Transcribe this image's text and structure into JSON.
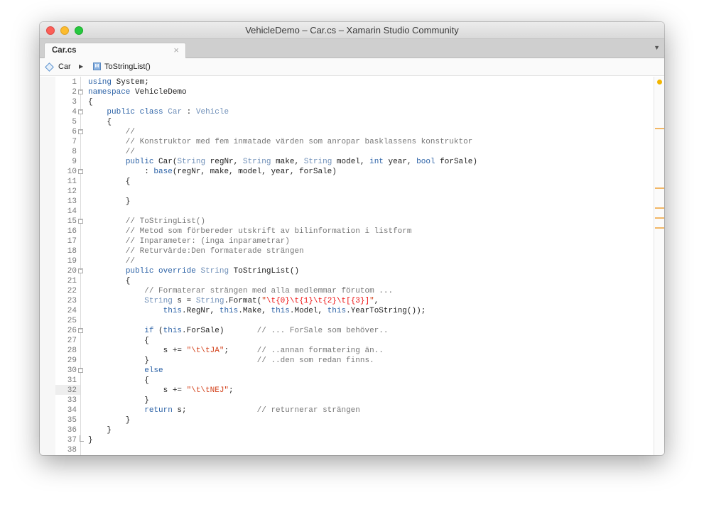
{
  "window": {
    "title": "VehicleDemo – Car.cs – Xamarin Studio Community"
  },
  "tabs": [
    {
      "label": "Car.cs",
      "close": "×"
    }
  ],
  "tab_dropdown": "▼",
  "breadcrumb": {
    "class_name": "Car",
    "separator": "▶",
    "method_icon_letter": "M",
    "method_name": "ToStringList()"
  },
  "editor": {
    "current_line": 32,
    "lines": [
      {
        "n": "1",
        "fold": "",
        "segs": [
          [
            "k",
            "using"
          ],
          [
            "p",
            " System;"
          ]
        ]
      },
      {
        "n": "2",
        "fold": "open",
        "segs": [
          [
            "k",
            "namespace"
          ],
          [
            "p",
            " VehicleDemo"
          ]
        ]
      },
      {
        "n": "3",
        "fold": "",
        "segs": [
          [
            "p",
            "{"
          ]
        ]
      },
      {
        "n": "4",
        "fold": "open",
        "segs": [
          [
            "p",
            "    "
          ],
          [
            "k",
            "public"
          ],
          [
            "p",
            " "
          ],
          [
            "k",
            "class"
          ],
          [
            "p",
            " "
          ],
          [
            "t",
            "Car"
          ],
          [
            "p",
            " : "
          ],
          [
            "t",
            "Vehicle"
          ]
        ]
      },
      {
        "n": "5",
        "fold": "",
        "segs": [
          [
            "p",
            "    {"
          ]
        ]
      },
      {
        "n": "6",
        "fold": "open",
        "segs": [
          [
            "c",
            "        //"
          ]
        ]
      },
      {
        "n": "7",
        "fold": "",
        "segs": [
          [
            "c",
            "        // Konstruktor med fem inmatade värden som anropar basklassens konstruktor"
          ]
        ]
      },
      {
        "n": "8",
        "fold": "",
        "segs": [
          [
            "c",
            "        //"
          ]
        ]
      },
      {
        "n": "9",
        "fold": "",
        "segs": [
          [
            "p",
            "        "
          ],
          [
            "k",
            "public"
          ],
          [
            "p",
            " Car("
          ],
          [
            "t",
            "String"
          ],
          [
            "p",
            " regNr, "
          ],
          [
            "t",
            "String"
          ],
          [
            "p",
            " make, "
          ],
          [
            "t",
            "String"
          ],
          [
            "p",
            " model, "
          ],
          [
            "k",
            "int"
          ],
          [
            "p",
            " year, "
          ],
          [
            "k",
            "bool"
          ],
          [
            "p",
            " forSale)"
          ]
        ]
      },
      {
        "n": "10",
        "fold": "open",
        "segs": [
          [
            "p",
            "            : "
          ],
          [
            "k",
            "base"
          ],
          [
            "p",
            "(regNr, make, model, year, forSale)"
          ]
        ]
      },
      {
        "n": "11",
        "fold": "",
        "segs": [
          [
            "p",
            "        {"
          ]
        ]
      },
      {
        "n": "12",
        "fold": "",
        "segs": []
      },
      {
        "n": "13",
        "fold": "",
        "segs": [
          [
            "p",
            "        }"
          ]
        ]
      },
      {
        "n": "14",
        "fold": "",
        "segs": []
      },
      {
        "n": "15",
        "fold": "open",
        "segs": [
          [
            "c",
            "        // ToStringList()"
          ]
        ]
      },
      {
        "n": "16",
        "fold": "",
        "segs": [
          [
            "c",
            "        // Metod som förbereder utskrift av bilinformation i listform"
          ]
        ]
      },
      {
        "n": "17",
        "fold": "",
        "segs": [
          [
            "c",
            "        // Inparameter: (inga inparametrar)"
          ]
        ]
      },
      {
        "n": "18",
        "fold": "",
        "segs": [
          [
            "c",
            "        // Returvärde:Den formaterade strängen"
          ]
        ]
      },
      {
        "n": "19",
        "fold": "",
        "segs": [
          [
            "c",
            "        //"
          ]
        ]
      },
      {
        "n": "20",
        "fold": "open",
        "segs": [
          [
            "p",
            "        "
          ],
          [
            "k",
            "public"
          ],
          [
            "p",
            " "
          ],
          [
            "k",
            "override"
          ],
          [
            "p",
            " "
          ],
          [
            "t",
            "String"
          ],
          [
            "p",
            " ToStringList()"
          ]
        ]
      },
      {
        "n": "21",
        "fold": "",
        "segs": [
          [
            "p",
            "        {"
          ]
        ]
      },
      {
        "n": "22",
        "fold": "",
        "segs": [
          [
            "c",
            "            // Formaterar strängen med alla medlemmar förutom ..."
          ]
        ]
      },
      {
        "n": "23",
        "fold": "",
        "segs": [
          [
            "p",
            "            "
          ],
          [
            "t",
            "String"
          ],
          [
            "p",
            " s = "
          ],
          [
            "t",
            "String"
          ],
          [
            "p",
            ".Format("
          ],
          [
            "s",
            "\""
          ],
          [
            "e",
            "\\t{0}\\t{1}\\t{2}\\t[{3}]"
          ],
          [
            "s",
            "\""
          ],
          [
            "p",
            ","
          ]
        ]
      },
      {
        "n": "24",
        "fold": "",
        "segs": [
          [
            "p",
            "                "
          ],
          [
            "k",
            "this"
          ],
          [
            "p",
            ".RegNr, "
          ],
          [
            "k",
            "this"
          ],
          [
            "p",
            ".Make, "
          ],
          [
            "k",
            "this"
          ],
          [
            "p",
            ".Model, "
          ],
          [
            "k",
            "this"
          ],
          [
            "p",
            ".YearToString());"
          ]
        ]
      },
      {
        "n": "25",
        "fold": "",
        "segs": []
      },
      {
        "n": "26",
        "fold": "open",
        "segs": [
          [
            "p",
            "            "
          ],
          [
            "k",
            "if"
          ],
          [
            "p",
            " ("
          ],
          [
            "k",
            "this"
          ],
          [
            "p",
            ".ForSale)       "
          ],
          [
            "c",
            "// ... ForSale som behöver.."
          ]
        ]
      },
      {
        "n": "27",
        "fold": "",
        "segs": [
          [
            "p",
            "            {"
          ]
        ]
      },
      {
        "n": "28",
        "fold": "",
        "segs": [
          [
            "p",
            "                s += "
          ],
          [
            "s",
            "\"\\t\\tJA\""
          ],
          [
            "p",
            ";      "
          ],
          [
            "c",
            "// ..annan formatering än.."
          ]
        ]
      },
      {
        "n": "29",
        "fold": "",
        "segs": [
          [
            "p",
            "            }                       "
          ],
          [
            "c",
            "// ..den som redan finns."
          ]
        ]
      },
      {
        "n": "30",
        "fold": "open",
        "segs": [
          [
            "p",
            "            "
          ],
          [
            "k",
            "else"
          ]
        ]
      },
      {
        "n": "31",
        "fold": "",
        "segs": [
          [
            "p",
            "            {"
          ]
        ]
      },
      {
        "n": "32",
        "fold": "",
        "segs": [
          [
            "p",
            "                s += "
          ],
          [
            "s",
            "\"\\t\\tNEJ\""
          ],
          [
            "p",
            ";"
          ]
        ]
      },
      {
        "n": "33",
        "fold": "",
        "segs": [
          [
            "p",
            "            }"
          ]
        ]
      },
      {
        "n": "34",
        "fold": "",
        "segs": [
          [
            "p",
            "            "
          ],
          [
            "k",
            "return"
          ],
          [
            "p",
            " s;               "
          ],
          [
            "c",
            "// returnerar strängen"
          ]
        ]
      },
      {
        "n": "35",
        "fold": "",
        "segs": [
          [
            "p",
            "        }"
          ]
        ]
      },
      {
        "n": "36",
        "fold": "",
        "segs": [
          [
            "p",
            "    }"
          ]
        ]
      },
      {
        "n": "37",
        "fold": "end",
        "segs": [
          [
            "p",
            "}"
          ]
        ]
      },
      {
        "n": "38",
        "fold": "",
        "segs": []
      }
    ]
  },
  "overview_ruler": {
    "dot_color": "#f2b500",
    "mark_color": "#f2b766",
    "marker_lines": [
      5,
      11,
      13,
      14,
      15
    ]
  },
  "colors": {
    "keyword": "#2d63a7",
    "type": "#6f8fb8",
    "comment": "#777777",
    "string": "#d3431d",
    "escape": "#ee1111"
  },
  "icons": {
    "class_icon": "class-diamond-icon",
    "method_icon": "method-square-icon",
    "close_icon": "close-icon",
    "dropdown_icon": "chevron-down-icon",
    "separator_icon": "chevron-right-icon"
  }
}
